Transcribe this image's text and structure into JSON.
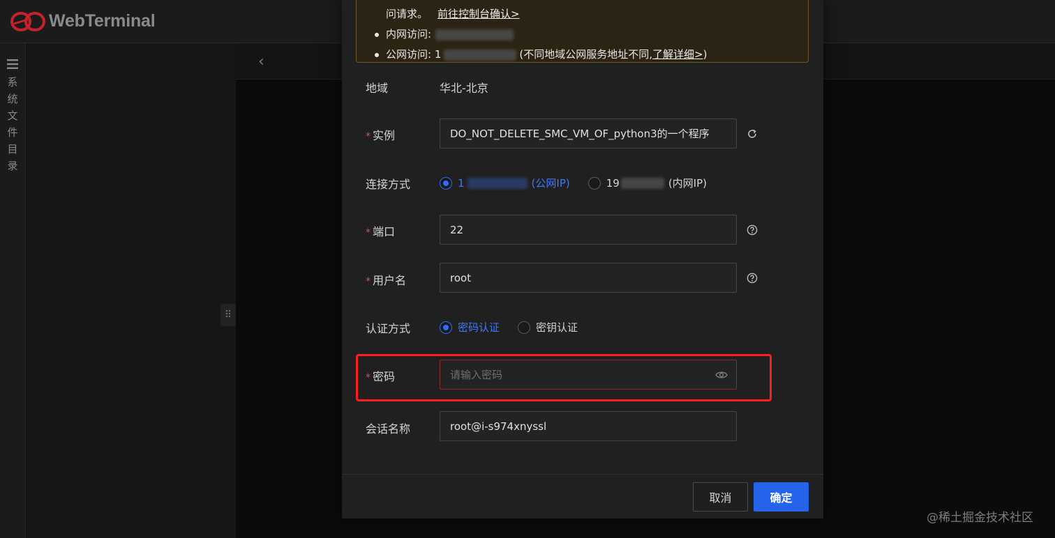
{
  "header": {
    "app_name": "WebTerminal",
    "brand_color": "#c4212b"
  },
  "sidebar": {
    "label": "系统文件目录"
  },
  "watermark": "@稀土掘金技术社区",
  "notice": {
    "line1_text": "问请求。",
    "line1_link": "前往控制台确认>",
    "private_label": "内网访问:",
    "public_label": "公网访问: 1",
    "public_note_prefix": "(不同地域公网服务地址不同,",
    "public_note_link": "了解详细>",
    "public_note_suffix": ")"
  },
  "form": {
    "region": {
      "label": "地域",
      "value": "华北-北京"
    },
    "instance": {
      "label": "实例",
      "value": "DO_NOT_DELETE_SMC_VM_OF_python3的一个程序"
    },
    "connection": {
      "label": "连接方式",
      "options": [
        {
          "prefix": "1",
          "suffix": "(公网IP)",
          "checked": true
        },
        {
          "prefix": "19",
          "suffix": "(内网IP)",
          "checked": false
        }
      ]
    },
    "port": {
      "label": "端口",
      "value": "22"
    },
    "username": {
      "label": "用户名",
      "value": "root"
    },
    "auth": {
      "label": "认证方式",
      "options": [
        {
          "label": "密码认证",
          "checked": true
        },
        {
          "label": "密钥认证",
          "checked": false
        }
      ]
    },
    "password": {
      "label": "密码",
      "placeholder": "请输入密码"
    },
    "session": {
      "label": "会话名称",
      "value": "root@i-s974xnyssl"
    }
  },
  "buttons": {
    "cancel": "取消",
    "ok": "确定"
  },
  "colors": {
    "accent": "#2563eb",
    "required": "#e5484d",
    "highlight": "#ff1f1f"
  }
}
